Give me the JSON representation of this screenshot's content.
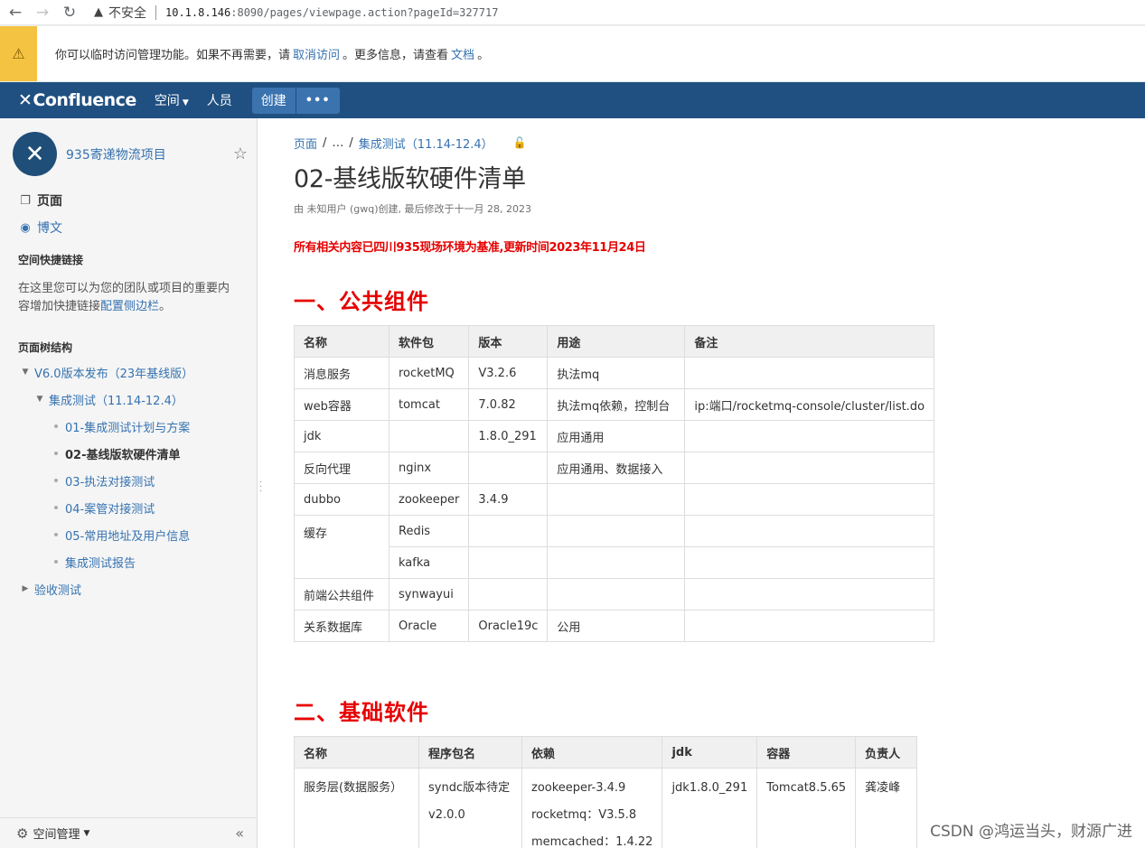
{
  "browser": {
    "insecure_label": "不安全",
    "url_host": "10.1.8.146",
    "url_rest": ":8090/pages/viewpage.action?pageId=327717"
  },
  "banner": {
    "text_before": "你可以临时访问管理功能。如果不再需要，请",
    "link_cancel": "取消访问",
    "text_middle": "。更多信息，请查看",
    "link_docs": "文档",
    "text_end": "。"
  },
  "header": {
    "logo": "Confluence",
    "nav_spaces": "空间",
    "nav_people": "人员",
    "create_label": "创建",
    "more_label": "•••"
  },
  "sidebar": {
    "space_name": "935寄递物流项目",
    "pages_label": "页面",
    "blog_label": "博文",
    "shortcuts_heading": "空间快捷链接",
    "shortcuts_text": "在这里您可以为您的团队或项目的重要内容增加快捷链接",
    "shortcuts_link": "配置侧边栏",
    "shortcuts_end": "。",
    "tree_heading": "页面树结构",
    "tree": {
      "root": "V6.0版本发布（23年基线版）",
      "parent": "集成测试（11.14-12.4）",
      "children": [
        "01-集成测试计划与方案",
        "02-基线版软硬件清单",
        "03-执法对接测试",
        "04-案管对接测试",
        "05-常用地址及用户信息",
        "集成测试报告"
      ],
      "sibling": "验收测试"
    },
    "footer_label": "空间管理"
  },
  "content": {
    "breadcrumb": [
      "页面",
      "…",
      "集成测试（11.14-12.4）"
    ],
    "title": "02-基线版软硬件清单",
    "meta": "由 未知用户 (gwq)创建, 最后修改于十一月 28, 2023",
    "notice": "所有相关内容已四川935现场环境为基准,更新时间2023年11月24日",
    "section1_title": "一、公共组件",
    "table1": {
      "headers": [
        "名称",
        "软件包",
        "版本",
        "用途",
        "备注"
      ],
      "rows": [
        [
          "消息服务",
          "rocketMQ",
          "V3.2.6",
          "执法mq",
          ""
        ],
        [
          "web容器",
          "tomcat",
          "7.0.82",
          "执法mq依赖，控制台",
          "ip:端口/rocketmq-console/cluster/list.do"
        ],
        [
          "jdk",
          "",
          "1.8.0_291",
          "应用通用",
          ""
        ],
        [
          "反向代理",
          "nginx",
          "",
          "应用通用、数据接入",
          ""
        ],
        [
          "dubbo",
          "zookeeper",
          "3.4.9",
          "",
          ""
        ],
        [
          "缓存",
          "Redis",
          "",
          "",
          ""
        ],
        [
          "",
          "kafka",
          "",
          "",
          ""
        ],
        [
          "前端公共组件",
          "synwayui",
          "",
          "",
          ""
        ],
        [
          "关系数据库",
          "Oracle",
          "Oracle19c",
          "公用",
          ""
        ]
      ]
    },
    "section2_title": "二、基础软件",
    "table2": {
      "headers": [
        "名称",
        "程序包名",
        "依赖",
        "jdk",
        "容器",
        "负责人"
      ],
      "row": {
        "name": "服务层(数据服务）",
        "pkg_line1": "syndc版本待定",
        "pkg_line2": "v2.0.0",
        "dep1": "zookeeper-3.4.9",
        "dep2": "rocketmq：V3.5.8",
        "dep3": "memcached：1.4.22",
        "jdk": "jdk1.8.0_291",
        "container": "Tomcat8.5.65",
        "owner": "龚凌峰"
      }
    }
  },
  "watermark": "CSDN @鸿运当头，财源广进"
}
